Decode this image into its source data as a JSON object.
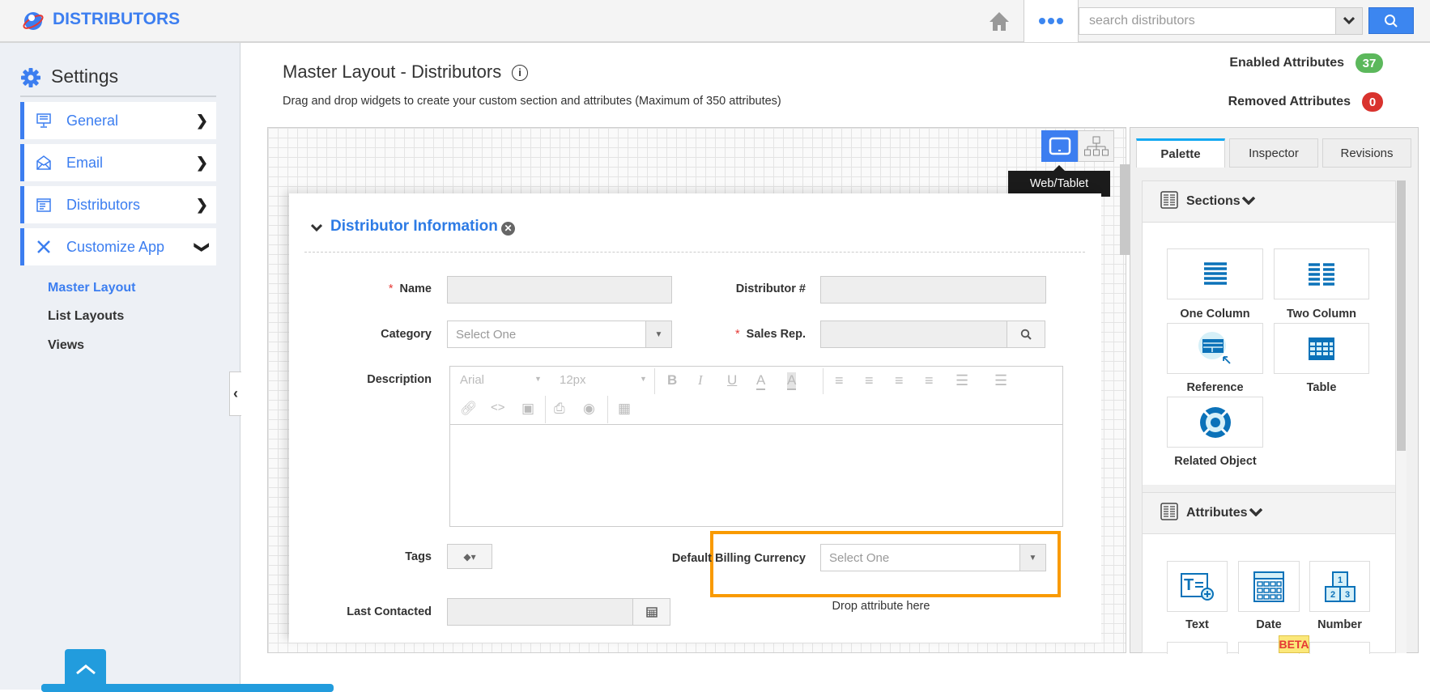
{
  "app": {
    "title": "DISTRIBUTORS",
    "brand_color": "#3c7ef0"
  },
  "header": {
    "search_placeholder": "search distributors"
  },
  "sidebar": {
    "title": "Settings",
    "items": [
      {
        "label": "General",
        "icon": "monitor-icon"
      },
      {
        "label": "Email",
        "icon": "envelope-icon"
      },
      {
        "label": "Distributors",
        "icon": "form-icon"
      },
      {
        "label": "Customize App",
        "icon": "tools-icon"
      }
    ],
    "subitems": [
      "Master Layout",
      "List Layouts",
      "Views"
    ]
  },
  "main": {
    "title": "Master Layout - Distributors",
    "description": "Drag and drop widgets to create your custom section and attributes (Maximum of 350 attributes)",
    "enabled_label": "Enabled Attributes",
    "enabled_count": "37",
    "removed_label": "Removed Attributes",
    "removed_count": "0",
    "tooltip": "Web/Tablet"
  },
  "form": {
    "section_title": "Distributor Information",
    "required_mark": "*",
    "fields": {
      "name": "Name",
      "distributor_no": "Distributor #",
      "category": "Category",
      "category_placeholder": "Select One",
      "sales_rep": "Sales Rep.",
      "description": "Description",
      "tags": "Tags",
      "default_billing_currency": "Default Billing Currency",
      "currency_placeholder": "Select One",
      "last_contacted": "Last Contacted"
    },
    "editor": {
      "font": "Arial",
      "size": "12px"
    },
    "drop_hint": "Drop attribute here"
  },
  "palette": {
    "tabs": [
      "Palette",
      "Inspector",
      "Revisions"
    ],
    "sections_header": "Sections",
    "sections": [
      "One Column",
      "Two Column",
      "Reference",
      "Table",
      "Related Object"
    ],
    "attributes_header": "Attributes",
    "attributes": [
      "Text",
      "Date",
      "Number"
    ],
    "beta": "BETA"
  }
}
